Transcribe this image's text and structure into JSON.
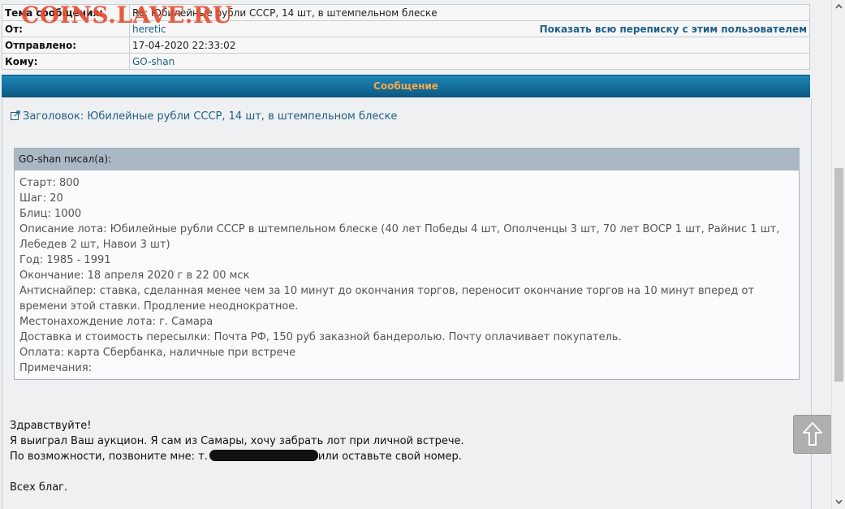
{
  "watermark": "COINS.LAVE.RU",
  "header": {
    "subject_label": "Тема сообщения:",
    "subject_value": "Re: Юбилейные рубли СССР, 14 шт, в штемпельном блеске",
    "from_label": "От:",
    "from_value": "heretic",
    "show_correspondence": "Показать всю переписку с этим пользователем",
    "sent_label": "Отправлено:",
    "sent_value": "17-04-2020 22:33:02",
    "to_label": "Кому:",
    "to_value": "GO-shan"
  },
  "message_bar": "Сообщение",
  "message": {
    "title_link": "Заголовок: Юбилейные рубли СССР, 14 шт, в штемпельном блеске",
    "quote_author": "GO-shan писал(а):",
    "quote_lines": [
      "Старт: 800",
      "Шаг: 20",
      "Блиц: 1000",
      "Описание лота: Юбилейные рубли СССР в штемпельном блеске (40 лет Победы 4 шт, Ополченцы 3 шт, 70 лет ВОСР 1 шт, Райнис 1 шт, Лебедев 2 шт, Навои 3 шт)",
      "Год: 1985 - 1991",
      "Окончание: 18 апреля 2020 г в 22 00 мск",
      "Антиснайпер: ставка, сделанная менее чем за 10 минут до окончания торгов, переносит окончание торгов на 10 минут вперед от времени этой ставки. Продление неоднократное.",
      "Местонахождение лота: г. Самара",
      "Доставка и стоимость пересылки: Почта РФ, 150 руб заказной бандеролью. Почту оплачивает покупатель.",
      "Оплата: карта Сбербанка, наличные при встрече",
      "Примечания:"
    ],
    "greeting": "Здравствуйте!",
    "line1": "Я выиграл Ваш аукцион. Я сам из Самары, хочу забрать лот при личной встрече.",
    "line2_before": "По возможности, позвоните мне: т.",
    "line2_after": "или оставьте свой номер.",
    "closing": "Всех благ."
  },
  "colors": {
    "bar_top": "#1d86b6",
    "bar_bottom": "#0d5a84",
    "bar_text": "#f5a94a",
    "link": "#1f5f87",
    "watermark": "#e74a2c"
  }
}
